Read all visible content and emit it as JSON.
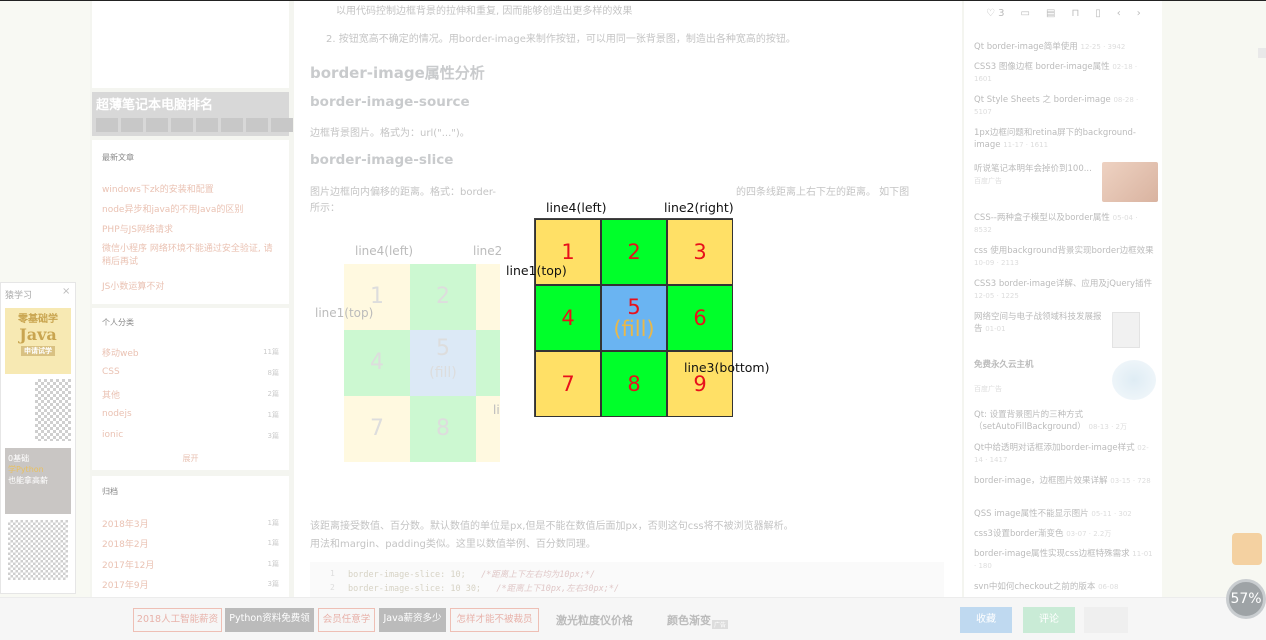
{
  "left_panel": {
    "title": "猿学习",
    "close": "×",
    "java_ad": {
      "line1": "零基础学",
      "line2": "Java",
      "badge": "申请试学"
    },
    "python_ad": {
      "line1": "0基础",
      "line2": "学Python",
      "line3": "也能拿高薪"
    }
  },
  "left_col": {
    "ad_title": "超薄笔记本电脑排名",
    "recent_title": "最新文章",
    "recent": [
      "windows下zk的安装和配置",
      "node异步和java的不用Java的区别",
      "PHP与JS网络请求",
      "微信小程序 网络环境不能通过安全验证, 请稍后再试",
      "JS小数运算不对"
    ],
    "category_title": "个人分类",
    "categories": [
      {
        "name": "移动web",
        "count": "11篇"
      },
      {
        "name": "CSS",
        "count": "8篇"
      },
      {
        "name": "其他",
        "count": "2篇"
      },
      {
        "name": "nodejs",
        "count": "1篇"
      },
      {
        "name": "ionic",
        "count": "3篇"
      }
    ],
    "expand": "展开",
    "archive_title": "归档",
    "archives": [
      {
        "name": "2018年3月",
        "count": "1篇"
      },
      {
        "name": "2018年2月",
        "count": "1篇"
      },
      {
        "name": "2017年12月",
        "count": "1篇"
      },
      {
        "name": "2017年9月",
        "count": "3篇"
      }
    ]
  },
  "main": {
    "p_top": "以用代码控制边框背景的拉伸和重复, 因而能够创造出更多样的效果",
    "p_item2": "2. 按钮宽高不确定的情况。用border-image来制作按钮，可以用同一张背景图，制造出各种宽高的按钮。",
    "h_analysis": "border-image属性分析",
    "h_source": "border-image-source",
    "p_source": "边框背景图片。格式为：url(\"...\")。",
    "h_slice": "border-image-slice",
    "p_slice_a": "图片边框向内偏移的距离。格式：border-",
    "p_slice_b": "的四条线距离上右下左的距离。 如下图",
    "p_slice_c": "所示：",
    "p_values": "该距离接受数值、百分数。默认数值的单位是px,但是不能在数值后面加px，否则这句css将不被浏览器解析。",
    "p_usage": "用法和margin、padding类似。这里以数值举例、百分数同理。",
    "code": [
      {
        "ln": "1",
        "code": "border-image-slice: 10;",
        "comment": "/*距离上下左右均为10px;*/"
      },
      {
        "ln": "2",
        "code": "border-image-slice: 10 30;",
        "comment": "/*距离上下10px,左右30px;*/"
      }
    ]
  },
  "diagram": {
    "labels": {
      "left": "line4(left)",
      "right": "line2(right)",
      "top": "line1(top)",
      "bottom": "line3(bottom)"
    },
    "cells": [
      "1",
      "2",
      "3",
      "4",
      "5",
      "6",
      "7",
      "8",
      "9"
    ],
    "fill": "(fill)",
    "colors": {
      "corner": "#ffe066",
      "edge": "#00ff2a",
      "center": "#6ab4f2",
      "number": "#e8111b",
      "fill_text": "#e9b84a"
    }
  },
  "faded_diagram": {
    "left": "line4(left)",
    "right": "line2",
    "top": "line1(top)",
    "bottom": "li",
    "cells": [
      "1",
      "2",
      "4",
      "5",
      "7",
      "8"
    ],
    "fill": "(fill)"
  },
  "right_col": {
    "likes": "3",
    "items": [
      {
        "title": "Qt border-image简单使用",
        "meta": "12-25 · 3942"
      },
      {
        "title": "CSS3 图像边框 border-image属性",
        "meta": "02-18 · 1601"
      },
      {
        "title": "Qt Style Sheets 之 border-image",
        "meta": "08-28 · 5107"
      },
      {
        "title": "1px边框问题和retina屏下的background-image",
        "meta": "11-17 · 1611"
      },
      {
        "title": "听说笔记本明年会掉价到100...",
        "meta": "百度广告"
      },
      {
        "title": "CSS--两种盒子模型以及border属性",
        "meta": "05-04 · 8532"
      },
      {
        "title": "css 使用background背景实现border边框效果",
        "meta": "10-09 · 2113"
      },
      {
        "title": "CSS3 border-image详解、应用及jQuery插件",
        "meta": "12-05 · 1225"
      },
      {
        "title": "网络空间与电子战领域科技发展报告",
        "meta": "01-01"
      },
      {
        "title": "免费永久云主机",
        "meta": "百度广告"
      },
      {
        "title": "Qt: 设置背景图片的三种方式（setAutoFillBackground）",
        "meta": "08-13 · 2万"
      },
      {
        "title": "Qt中给透明对话框添加border-image样式",
        "meta": "02-14 · 1417"
      },
      {
        "title": "border-image，边框图片效果详解",
        "meta": "03-15 · 728"
      },
      {
        "title": "QSS image属性不能显示图片",
        "meta": "05-11 · 302"
      },
      {
        "title": "css3设置border渐变色",
        "meta": "03-07 · 2.2万"
      },
      {
        "title": "border-image属性实现css边框特殊需求",
        "meta": "11-01 · 180"
      },
      {
        "title": "svn中如何checkout之前的版本",
        "meta": "06-08"
      }
    ]
  },
  "bottom_bar": {
    "ai": "2018人工智能薪资",
    "python": "Python资料免费领",
    "vip": "会员任意学",
    "java": "Java薪资多少",
    "code": "怎样才能不被裁员",
    "laser": "激光粒度仪价格",
    "color": "颜色渐变",
    "ad": "广告",
    "collect": "收藏",
    "comment": "评论"
  },
  "progress": "57%"
}
